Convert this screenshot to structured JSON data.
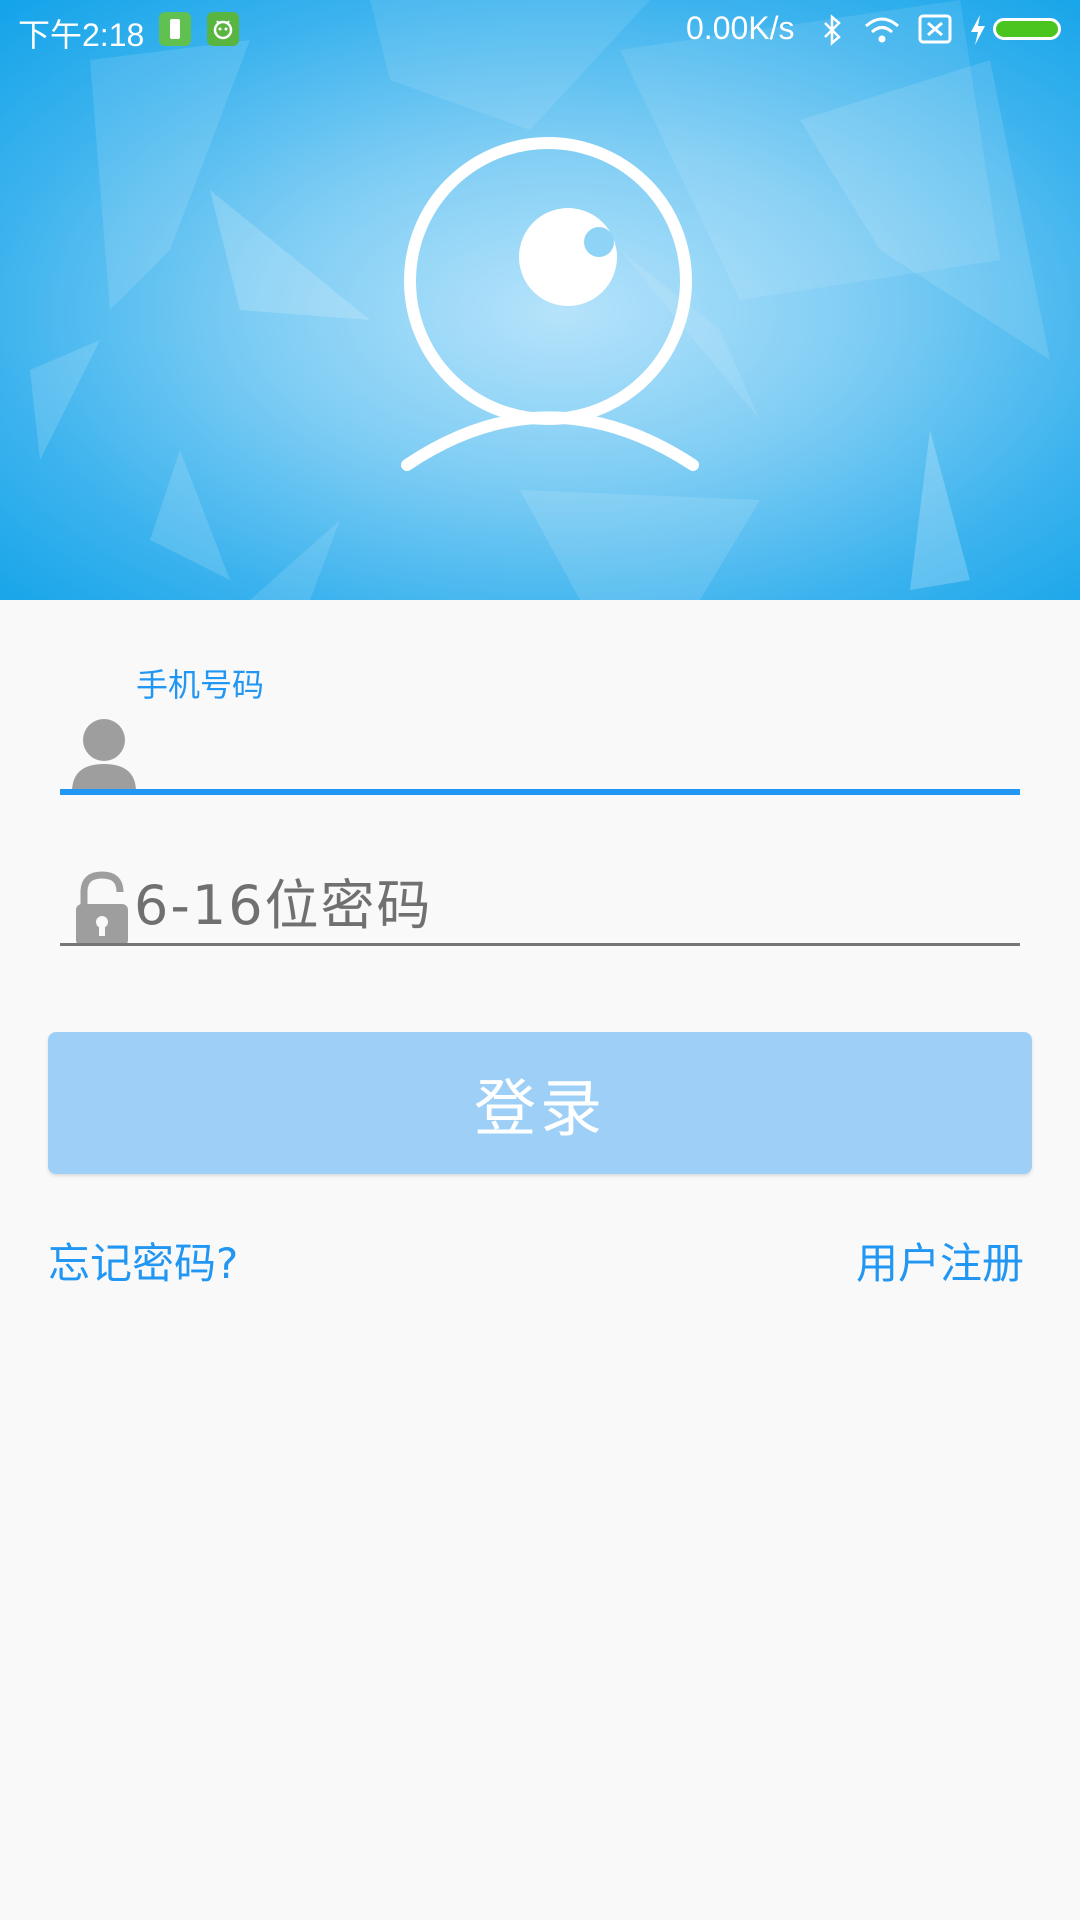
{
  "status_bar": {
    "time": "下午2:18",
    "network_speed": "0.00K/s",
    "icons": [
      "battery-saver-icon",
      "android-icon",
      "bluetooth-icon",
      "wifi-icon",
      "sim-off-icon",
      "charging-icon",
      "battery-icon"
    ]
  },
  "header": {
    "logo_icon": "webcam-eye-icon"
  },
  "login_form": {
    "phone": {
      "floating_label": "手机号码",
      "value": "",
      "icon": "user-icon"
    },
    "password": {
      "placeholder": "6-16位密码",
      "value": "",
      "icon": "lock-open-icon"
    },
    "login_button": "登录",
    "forgot_password": "忘记密码?",
    "register": "用户注册"
  },
  "colors": {
    "accent": "#2196f3",
    "button_disabled": "#9ed0f7",
    "header_blue": "#12a3e9",
    "background": "#f9f9f9"
  }
}
